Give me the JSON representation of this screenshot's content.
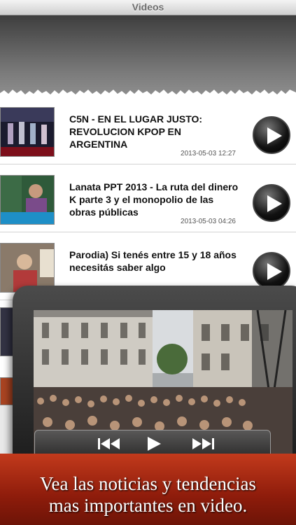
{
  "header": {
    "title": "Videos"
  },
  "videos": [
    {
      "title": "C5N - EN EL LUGAR JUSTO: REVOLUCION KPOP EN ARGENTINA",
      "date": "2013-05-03 12:27"
    },
    {
      "title": "Lanata PPT 2013 - La ruta del dinero K parte 3 y el monopolio de las obras públicas",
      "date": "2013-05-03 04:26"
    },
    {
      "title": "Parodia) Si tenés entre 15 y 18 años necesitás saber algo",
      "date": ""
    }
  ],
  "player": {
    "progress": 0.0
  },
  "promo": {
    "line1": "Vea las noticias y tendencias",
    "line2": "mas importantes en video."
  },
  "colors": {
    "promo_red": "#a82a12",
    "accent_black": "#000000"
  }
}
